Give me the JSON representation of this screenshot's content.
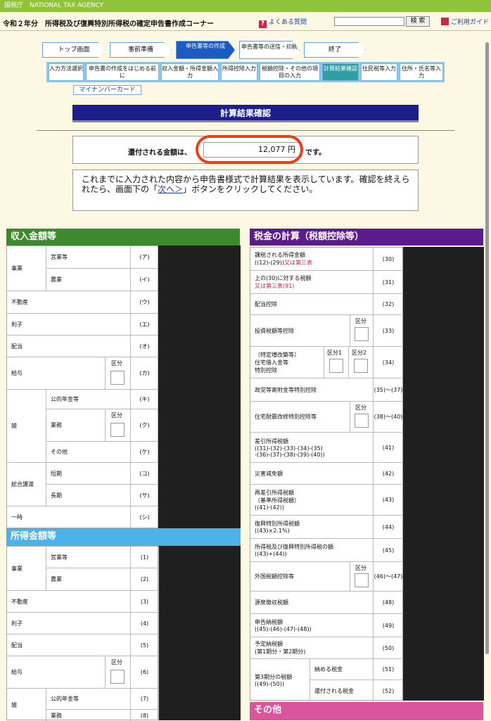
{
  "agency": "国税庁　NATIONAL TAX AGENCY",
  "header": {
    "title": "令和２年分　所得税及び復興特別所得税の確定申告書作成コーナー",
    "faq": "よくある質問",
    "search_button": "検 索",
    "help": "ご利用ガイド"
  },
  "steps": [
    "トップ画面",
    "事前準備",
    "申告書等の作成",
    "申告書等の送信・印刷",
    "終了"
  ],
  "substeps": [
    "入力方法選択",
    "申告書の作成をはじめる前に",
    "収入金額・所得金額入力",
    "所得控除入力",
    "税額控除・その他の項目の入力",
    "計算結果確認",
    "住民税等入力",
    "住所・氏名等入力"
  ],
  "mynumber": "マイナンバーカード",
  "page_title": "計算結果確認",
  "refund": {
    "label": "還付される金額は、",
    "amount": "12,077 円",
    "suffix": "です。"
  },
  "message": {
    "line1": "これまでに入力された内容から申告書様式で計算結果を表示しています。確認を終えられたら、画面下の「",
    "link": "次へ＞",
    "line2": "」ボタンをクリックしてください。"
  },
  "income": {
    "title": "収入金額等",
    "kubun": "区分",
    "jigyo": "事業",
    "eigyo": "営業等",
    "nogyo": "農業",
    "fudosan": "不動産",
    "rishi": "利子",
    "haito": "配当",
    "kyuyo": "給与",
    "zatsu": "雑",
    "koteki": "公的年金等",
    "gyomu": "業務",
    "sonota": "その他",
    "sogo": "総合譲渡",
    "tanki": "短期",
    "choki": "長期",
    "ichiji": "一時",
    "codes": [
      "(ア)",
      "(イ)",
      "(ウ)",
      "(エ)",
      "(オ)",
      "(カ)",
      "(キ)",
      "(ク)",
      "(ケ)",
      "(コ)",
      "(サ)",
      "(シ)"
    ]
  },
  "shotoku": {
    "title": "所得金額等",
    "codes": [
      "(1)",
      "(2)",
      "(3)",
      "(4)",
      "(5)",
      "(6)",
      "(7)",
      "(8)"
    ],
    "gyomu": "業務"
  },
  "tax": {
    "title": "税金の計算（税額控除等）",
    "r30a": "課税される所得金額",
    "r30b": "((12)-(29))",
    "r30c": "又は第三表",
    "r31a": "上の(30)に対する税額",
    "r31b": "又は第三表(91)",
    "r32": "配当控除",
    "r33": "投資税額等控除",
    "r34a": "（特定増改築等）",
    "r34b": "住宅借入金等",
    "r34c": "特別控除",
    "kubun1": "区分1",
    "kubun2": "区分2",
    "r35": "政党等寄附金等特別控除",
    "r38": "住宅耐震改修特別控除等",
    "r41a": "差引所得税額",
    "r41b": "((31)-(32)-(33)-(34)-(35)",
    "r41c": "-(36)-(37)-(38)-(39)-(40))",
    "r42": "災害減免額",
    "r43a": "再差引所得税額",
    "r43b": "（基準所得税額）",
    "r43c": "((41)-(42))",
    "r44a": "復興特別所得税額",
    "r44b": "((43)×2.1%)",
    "r45a": "所得税及び復興特別所得税の額",
    "r45b": "((43)+(44))",
    "r46": "外国税額控除等",
    "r48": "源泉徴収税額",
    "r49a": "申告納税額",
    "r49b": "((45)-(46)-(47)-(48))",
    "r50a": "予定納税額",
    "r50b": "(第1期分・第2期分)",
    "r51a": "第3期分の税額",
    "r51b": "((49)-(50))",
    "nomeru": "納める税金",
    "kanpu": "還付される税金",
    "codes": [
      "(30)",
      "(31)",
      "(32)",
      "(33)",
      "(34)",
      "(35)～(37)",
      "(38)～(40)",
      "(41)",
      "(42)",
      "(43)",
      "(44)",
      "(45)",
      "(46)～(47)",
      "(48)",
      "(49)",
      "(50)",
      "(51)",
      "(52)"
    ]
  },
  "other": {
    "title": "その他"
  },
  "colors": {
    "income": "#3d8a2e",
    "shotoku": "#4cb2ea",
    "tax": "#5c1b8c",
    "other": "#d9559c"
  }
}
